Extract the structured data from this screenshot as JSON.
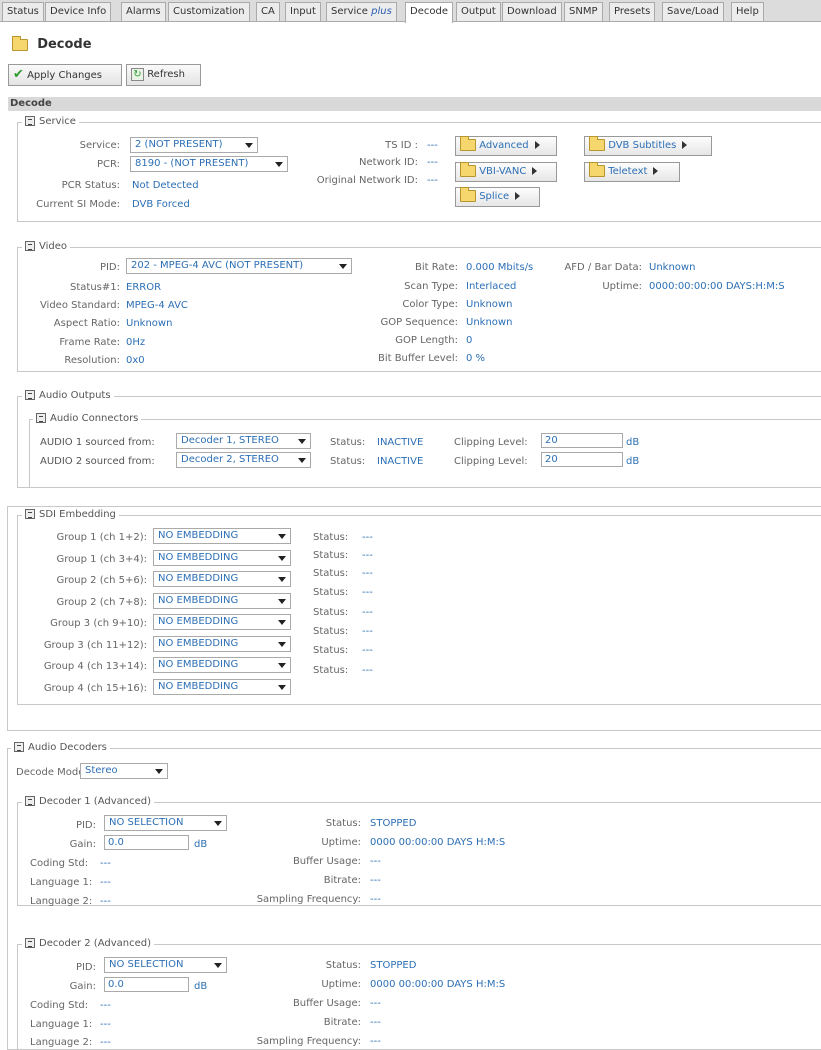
{
  "tabs": [
    {
      "label": "Status"
    },
    {
      "label": "Device Info"
    },
    {
      "label": "Alarms"
    },
    {
      "label": "Customization"
    },
    {
      "label": "CA"
    },
    {
      "label": "Input"
    },
    {
      "label": "Service",
      "suffix": "plus"
    },
    {
      "label": "Decode"
    },
    {
      "label": "Output"
    },
    {
      "label": "Download"
    },
    {
      "label": "SNMP"
    },
    {
      "label": "Presets"
    },
    {
      "label": "Save/Load"
    },
    {
      "label": "Help"
    }
  ],
  "page": {
    "title": "Decode",
    "section_bar": "Decode"
  },
  "toolbar": {
    "apply": "Apply Changes",
    "refresh": "Refresh"
  },
  "service": {
    "legend": "Service",
    "service_label": "Service:",
    "service_value": "2 (NOT PRESENT)",
    "pcr_label": "PCR:",
    "pcr_value": "8190 - (NOT PRESENT)",
    "pcr_status_label": "PCR Status:",
    "pcr_status_value": "Not Detected",
    "si_mode_label": "Current SI Mode:",
    "si_mode_value": "DVB Forced",
    "tsid_label": "TS ID :",
    "tsid_value": "---",
    "netid_label": "Network ID:",
    "netid_value": "---",
    "orig_netid_label": "Original Network ID:",
    "orig_netid_value": "---",
    "btn_advanced": "Advanced",
    "btn_vbi": "VBI-VANC",
    "btn_splice": "Splice",
    "btn_dvbsub": "DVB Subtitles",
    "btn_teletext": "Teletext"
  },
  "video": {
    "legend": "Video",
    "pid_label": "PID:",
    "pid_value": "202 - MPEG-4 AVC (NOT PRESENT)",
    "status_label": "Status#1:",
    "status_value": "ERROR",
    "std_label": "Video Standard:",
    "std_value": "MPEG-4 AVC",
    "aspect_label": "Aspect Ratio:",
    "aspect_value": "Unknown",
    "frame_label": "Frame Rate:",
    "frame_value": "0Hz",
    "res_label": "Resolution:",
    "res_value": "0x0",
    "bitrate_label": "Bit Rate:",
    "bitrate_value": "0.000 Mbits/s",
    "scan_label": "Scan Type:",
    "scan_value": "Interlaced",
    "color_label": "Color Type:",
    "color_value": "Unknown",
    "gopseq_label": "GOP Sequence:",
    "gopseq_value": "Unknown",
    "goplen_label": "GOP Length:",
    "goplen_value": "0",
    "bitbuf_label": "Bit Buffer Level:",
    "bitbuf_value": "0 %",
    "afd_label": "AFD / Bar Data:",
    "afd_value": "Unknown",
    "uptime_label": "Uptime:",
    "uptime_value": "0000:00:00:00 DAYS:H:M:S"
  },
  "audio_outputs": {
    "legend": "Audio Outputs",
    "connectors_legend": "Audio Connectors",
    "rows": [
      {
        "label": "AUDIO 1 sourced from:",
        "source": "Decoder 1, STEREO",
        "status_label": "Status:",
        "status": "INACTIVE",
        "clip_label": "Clipping Level:",
        "clip": "20",
        "unit": "dB"
      },
      {
        "label": "AUDIO 2 sourced from:",
        "source": "Decoder 2, STEREO",
        "status_label": "Status:",
        "status": "INACTIVE",
        "clip_label": "Clipping Level:",
        "clip": "20",
        "unit": "dB"
      }
    ]
  },
  "sdi": {
    "legend": "SDI Embedding",
    "groups": [
      {
        "label": "Group 1 (ch 1+2):",
        "value": "NO EMBEDDING"
      },
      {
        "label": "Group 1 (ch 3+4):",
        "value": "NO EMBEDDING"
      },
      {
        "label": "Group 2 (ch 5+6):",
        "value": "NO EMBEDDING"
      },
      {
        "label": "Group 2 (ch 7+8):",
        "value": "NO EMBEDDING"
      },
      {
        "label": "Group 3 (ch 9+10):",
        "value": "NO EMBEDDING"
      },
      {
        "label": "Group 3 (ch 11+12):",
        "value": "NO EMBEDDING"
      },
      {
        "label": "Group 4 (ch 13+14):",
        "value": "NO EMBEDDING"
      },
      {
        "label": "Group 4 (ch 15+16):",
        "value": "NO EMBEDDING"
      }
    ],
    "status_label": "Status:",
    "status_value": "---"
  },
  "audio_decoders": {
    "legend": "Audio Decoders",
    "mode_label": "Decode Mode:",
    "mode_value": "Stereo",
    "decoders": [
      {
        "legend": "Decoder 1 (Advanced)",
        "pid_label": "PID:",
        "pid": "NO SELECTION",
        "gain_label": "Gain:",
        "gain": "0.0",
        "gain_unit": "dB",
        "coding_label": "Coding Std:",
        "coding": "---",
        "lang1_label": "Language 1:",
        "lang1": "---",
        "lang2_label": "Language 2:",
        "lang2": "---",
        "status_label": "Status:",
        "status": "STOPPED",
        "uptime_label": "Uptime:",
        "uptime": "0000 00:00:00 DAYS H:M:S",
        "buffer_label": "Buffer Usage:",
        "buffer": "---",
        "bitrate_label": "Bitrate:",
        "bitrate": "---",
        "sampling_label": "Sampling Frequency:",
        "sampling": "---"
      },
      {
        "legend": "Decoder 2 (Advanced)",
        "pid_label": "PID:",
        "pid": "NO SELECTION",
        "gain_label": "Gain:",
        "gain": "0.0",
        "gain_unit": "dB",
        "coding_label": "Coding Std:",
        "coding": "---",
        "lang1_label": "Language 1:",
        "lang1": "---",
        "lang2_label": "Language 2:",
        "lang2": "---",
        "status_label": "Status:",
        "status": "STOPPED",
        "uptime_label": "Uptime:",
        "uptime": "0000 00:00:00 DAYS H:M:S",
        "buffer_label": "Buffer Usage:",
        "buffer": "---",
        "bitrate_label": "Bitrate:",
        "bitrate": "---",
        "sampling_label": "Sampling Frequency:",
        "sampling": "---"
      }
    ]
  }
}
